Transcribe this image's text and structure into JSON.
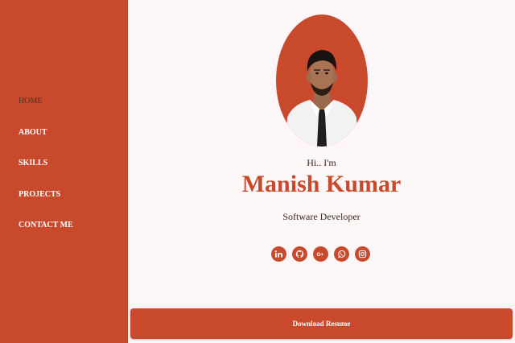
{
  "sidebar": {
    "items": [
      {
        "label": "HOME",
        "active": true
      },
      {
        "label": "ABOUT"
      },
      {
        "label": "SKILLS"
      },
      {
        "label": "PROJECTS"
      },
      {
        "label": "CONTACT ME"
      }
    ]
  },
  "hero": {
    "greeting": "Hi.. I'm",
    "name": "Manish Kumar",
    "role": "Software Developer"
  },
  "socials": [
    {
      "icon": "linkedin-icon"
    },
    {
      "icon": "github-icon"
    },
    {
      "icon": "google-plus-icon"
    },
    {
      "icon": "whatsapp-icon"
    },
    {
      "icon": "instagram-icon"
    }
  ],
  "download_resume_label": "Download Resume",
  "colors": {
    "accent": "#c9492d",
    "background": "#fdf8f7"
  }
}
